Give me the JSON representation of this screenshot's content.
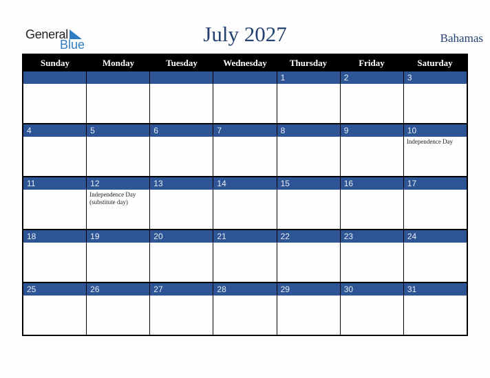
{
  "logo": {
    "word1": "General",
    "word2": "Blue"
  },
  "header": {
    "title": "July 2027",
    "country": "Bahamas"
  },
  "weekdays": [
    "Sunday",
    "Monday",
    "Tuesday",
    "Wednesday",
    "Thursday",
    "Friday",
    "Saturday"
  ],
  "weeks": [
    {
      "days": [
        "",
        "",
        "",
        "",
        "1",
        "2",
        "3"
      ],
      "events": [
        "",
        "",
        "",
        "",
        "",
        "",
        ""
      ]
    },
    {
      "days": [
        "4",
        "5",
        "6",
        "7",
        "8",
        "9",
        "10"
      ],
      "events": [
        "",
        "",
        "",
        "",
        "",
        "",
        "Independence Day"
      ]
    },
    {
      "days": [
        "11",
        "12",
        "13",
        "14",
        "15",
        "16",
        "17"
      ],
      "events": [
        "",
        "Independence Day (substitute day)",
        "",
        "",
        "",
        "",
        ""
      ]
    },
    {
      "days": [
        "18",
        "19",
        "20",
        "21",
        "22",
        "23",
        "24"
      ],
      "events": [
        "",
        "",
        "",
        "",
        "",
        "",
        ""
      ]
    },
    {
      "days": [
        "25",
        "26",
        "27",
        "28",
        "29",
        "30",
        "31"
      ],
      "events": [
        "",
        "",
        "",
        "",
        "",
        "",
        ""
      ]
    }
  ],
  "colors": {
    "day_bar": "#2d5595",
    "header_bg": "#000000",
    "title": "#23406e",
    "logo_blue": "#2e7cc4"
  }
}
